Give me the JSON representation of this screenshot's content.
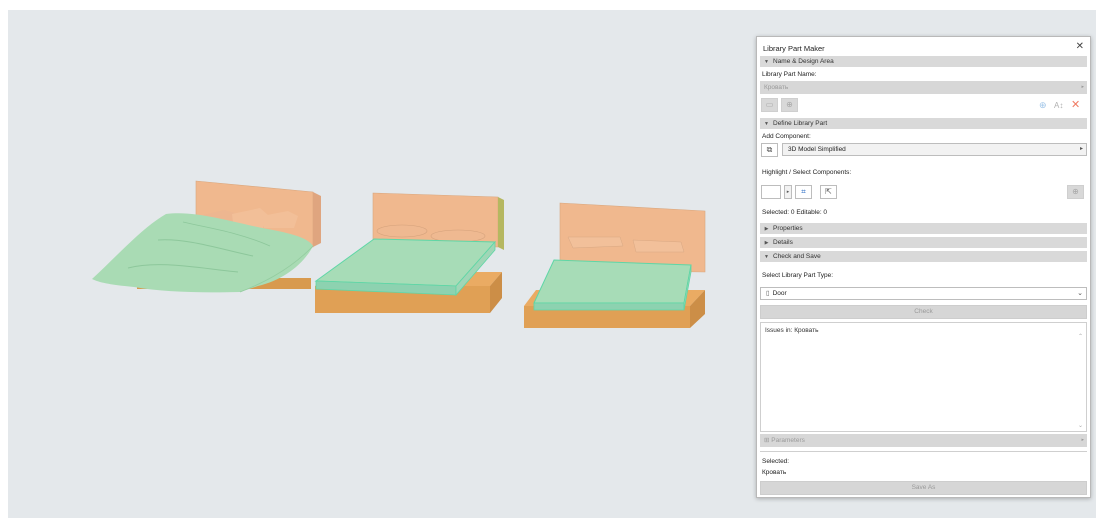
{
  "panel": {
    "title": "Library Part Maker",
    "close_icon": "close-icon",
    "sections": {
      "name_design": "Name & Design Area",
      "define": "Define Library Part",
      "properties": "Properties",
      "details": "Details",
      "check_save": "Check and Save"
    },
    "name_label": "Library Part Name:",
    "name_value": "Кровать",
    "add_component_label": "Add Component:",
    "component_type": "3D Model Simplified",
    "highlight_label": "Highlight / Select Components:",
    "selected_editable": "Selected: 0 Editable: 0",
    "part_type_label": "Select Library Part Type:",
    "part_type": "Door",
    "check_button": "Check",
    "issues_text": "Issues in: Кровать",
    "parameters_label": "Parameters",
    "selected_label": "Selected:",
    "selected_value": "Кровать",
    "save_as_button": "Save As"
  },
  "colors": {
    "viewport_bg": "#e4e8eb",
    "wood": "#f0b88e",
    "frame": "#df9d52",
    "sheet": "#a7dcb7",
    "sheet_edge": "#5fd6a6",
    "pillow": "#eab58f"
  }
}
